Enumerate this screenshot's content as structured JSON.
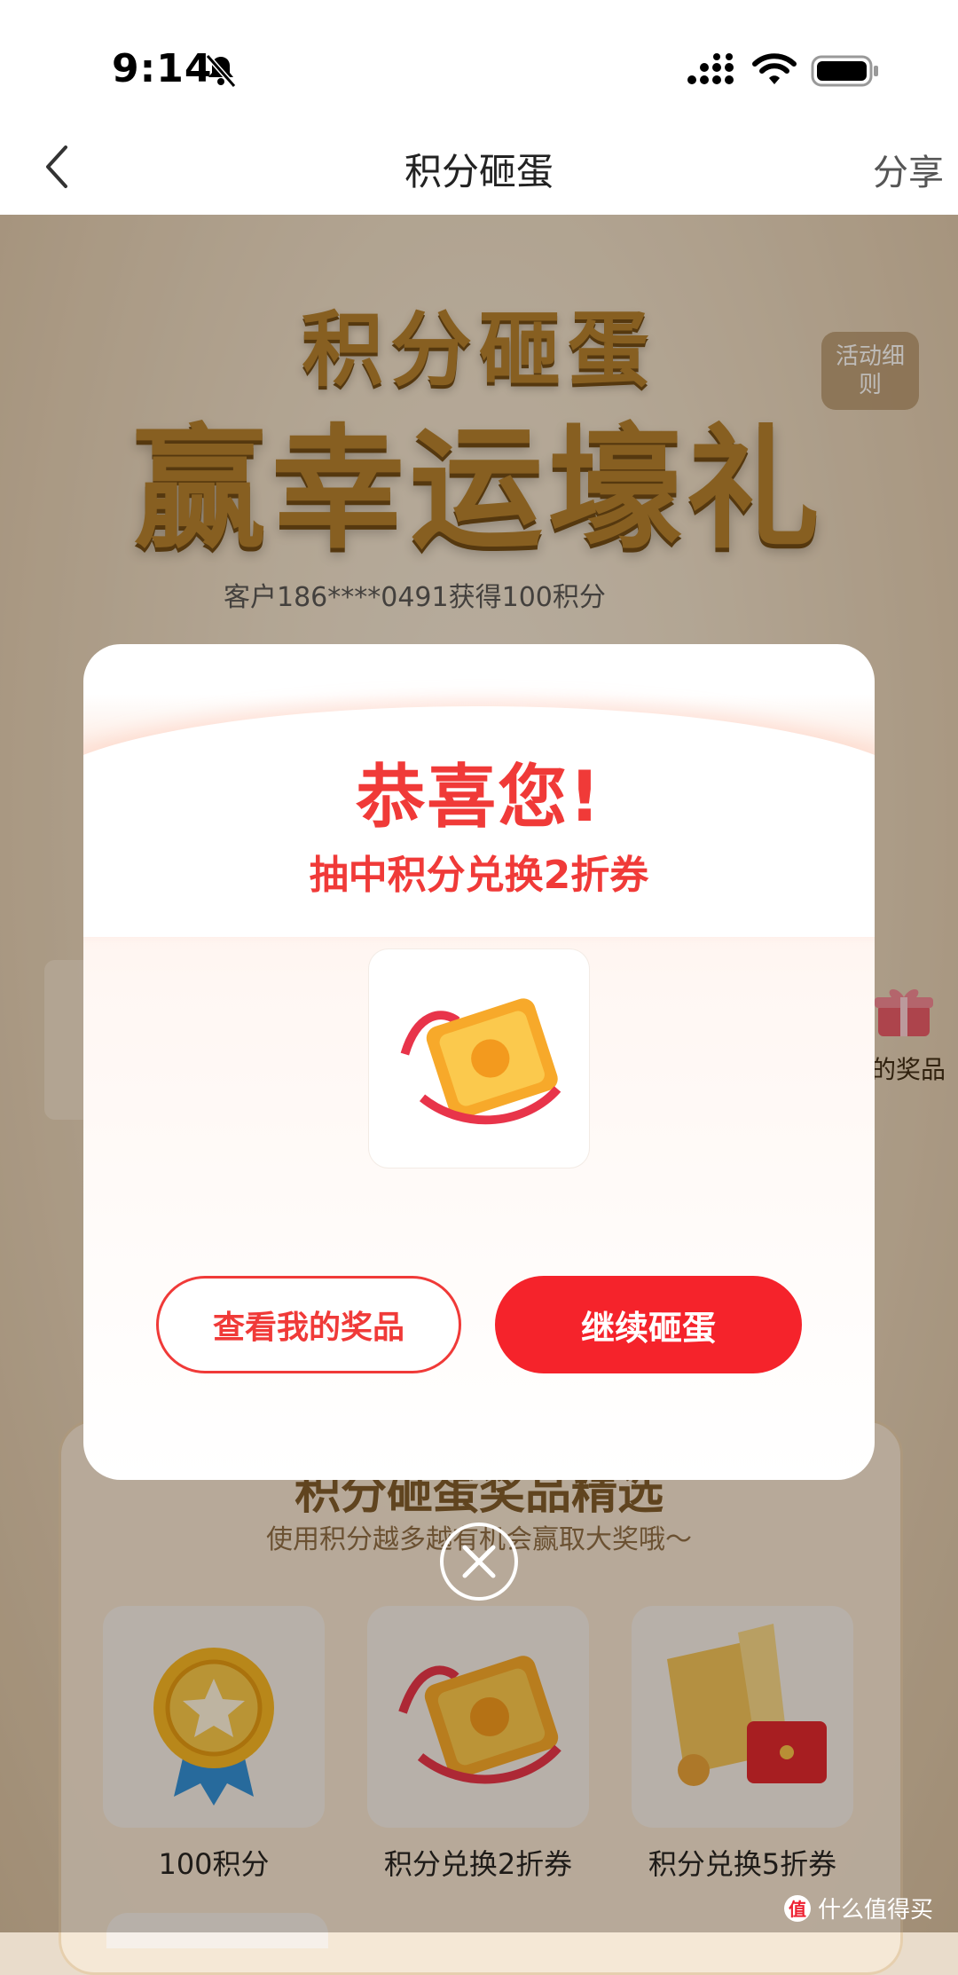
{
  "status_bar": {
    "time": "9:14",
    "icons": [
      "bell-muted-icon",
      "signal-icon",
      "wifi-icon",
      "battery-icon"
    ]
  },
  "nav": {
    "title": "积分砸蛋",
    "share": "分享",
    "back_icon": "chevron-left-icon"
  },
  "hero": {
    "line1": "积分砸蛋",
    "line2": "赢幸运壕礼",
    "rules_button": "活动细则",
    "ticker": "客户186****0491获得100积分",
    "side_prize_label": "的奖品"
  },
  "modal": {
    "title": "恭喜您!",
    "subtitle": "抽中积分兑换2折券",
    "prize_icon": "coupon-icon",
    "view_prizes_button": "查看我的奖品",
    "continue_button": "继续砸蛋",
    "close_icon": "close-circle-icon"
  },
  "showcase": {
    "title": "积分砸蛋奖品精选",
    "subtitle": "使用积分越多越有机会赢取大奖哦～",
    "prizes": [
      {
        "label": "100积分",
        "icon": "medal-icon"
      },
      {
        "label": "积分兑换2折券",
        "icon": "coupon-icon"
      },
      {
        "label": "积分兑换5折券",
        "icon": "ticket-redpacket-icon"
      }
    ]
  },
  "watermark": {
    "badge": "值",
    "text": "什么值得买"
  },
  "colors": {
    "accent_red": "#f03a38",
    "button_red": "#f5232b",
    "gold": "#b3802e"
  }
}
